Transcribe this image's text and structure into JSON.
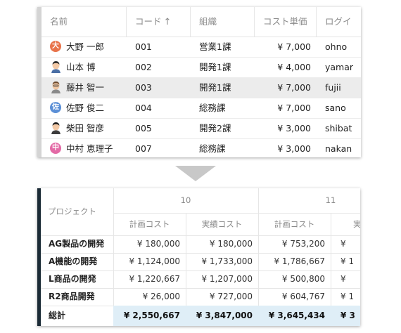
{
  "members_table": {
    "columns": [
      {
        "label": "名前"
      },
      {
        "label": "コード",
        "sort_icon": "sort-ascending-icon"
      },
      {
        "label": "組織"
      },
      {
        "label": "コスト単価"
      },
      {
        "label": "ログイ"
      }
    ],
    "rows": [
      {
        "avatar": {
          "type": "initial",
          "text": "大",
          "color": "#e8734a"
        },
        "name": "大野 一郎",
        "code": "001",
        "org": "営業1課",
        "cost": "¥ 7,000",
        "login": "ohno"
      },
      {
        "avatar": {
          "type": "photo-icon"
        },
        "name": "山本 博",
        "code": "002",
        "org": "開発1課",
        "cost": "¥ 4,000",
        "login": "yamar"
      },
      {
        "avatar": {
          "type": "photo-icon"
        },
        "name": "藤井 智一",
        "code": "003",
        "org": "開発1課",
        "cost": "¥ 7,000",
        "login": "fujii",
        "highlighted": true
      },
      {
        "avatar": {
          "type": "initial",
          "text": "佐",
          "color": "#5b8fd6"
        },
        "name": "佐野 俊二",
        "code": "004",
        "org": "総務課",
        "cost": "¥ 7,000",
        "login": "sano"
      },
      {
        "avatar": {
          "type": "photo-icon"
        },
        "name": "柴田 智彦",
        "code": "005",
        "org": "開発2課",
        "cost": "¥ 3,000",
        "login": "shibat"
      },
      {
        "avatar": {
          "type": "initial",
          "text": "中",
          "color": "#e36aa6"
        },
        "name": "中村 恵理子",
        "code": "007",
        "org": "総務課",
        "cost": "¥ 3,000",
        "login": "nakan"
      }
    ]
  },
  "project_table": {
    "project_header": "プロジェクト",
    "months": [
      "10",
      "11"
    ],
    "sub_headers": [
      "計画コスト",
      "実績コスト",
      "計画コスト",
      "実"
    ],
    "rows": [
      {
        "name": "AG製品の開発",
        "values": [
          "¥ 180,000",
          "¥ 180,000",
          "¥ 753,200",
          "¥"
        ]
      },
      {
        "name": "A機能の開発",
        "values": [
          "¥ 1,124,000",
          "¥ 1,733,000",
          "¥ 1,786,667",
          "¥ 1"
        ]
      },
      {
        "name": "L商品の開発",
        "values": [
          "¥ 1,220,667",
          "¥ 1,207,000",
          "¥ 500,800",
          "¥"
        ]
      },
      {
        "name": "R2商品開発",
        "values": [
          "¥ 26,000",
          "¥ 727,000",
          "¥ 604,767",
          "¥ 1"
        ]
      }
    ],
    "total": {
      "name": "総計",
      "values": [
        "¥ 2,550,667",
        "¥ 3,847,000",
        "¥ 3,645,434",
        "¥ 3"
      ]
    }
  },
  "colors": {
    "total_row_bg": "#dfeef7",
    "panel_left_bar": "#1b2b36",
    "arrow": "#c8c8c8"
  }
}
